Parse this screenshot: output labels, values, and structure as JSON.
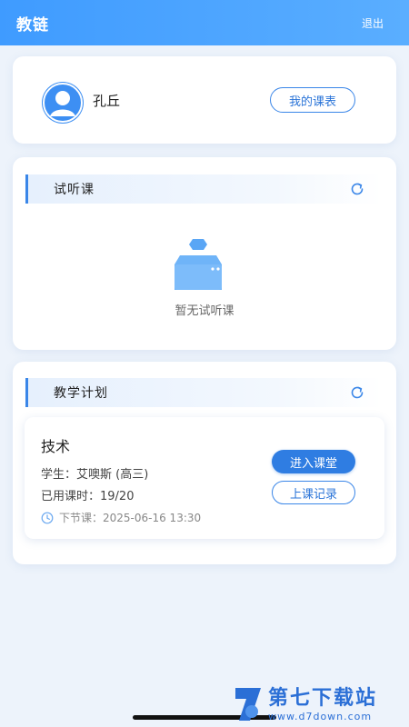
{
  "header": {
    "title": "教链",
    "logout_label": "退出"
  },
  "user": {
    "name": "孔丘",
    "schedule_label": "我的课表"
  },
  "trial": {
    "title": "试听课",
    "empty_text": "暂无试听课"
  },
  "plan": {
    "title": "教学计划",
    "items": [
      {
        "course": "技术",
        "student": "学生：艾噢斯 (高三)",
        "hours": "已用课时：19/20",
        "next": "下节课：2025-06-16 13:30",
        "enter_label": "进入课堂",
        "records_label": "上课记录"
      }
    ]
  },
  "watermark": {
    "main": "第七下载站",
    "sub": "www.d7down.com"
  },
  "colors": {
    "accent": "#3a86e8",
    "header": "#4aa3ff"
  }
}
